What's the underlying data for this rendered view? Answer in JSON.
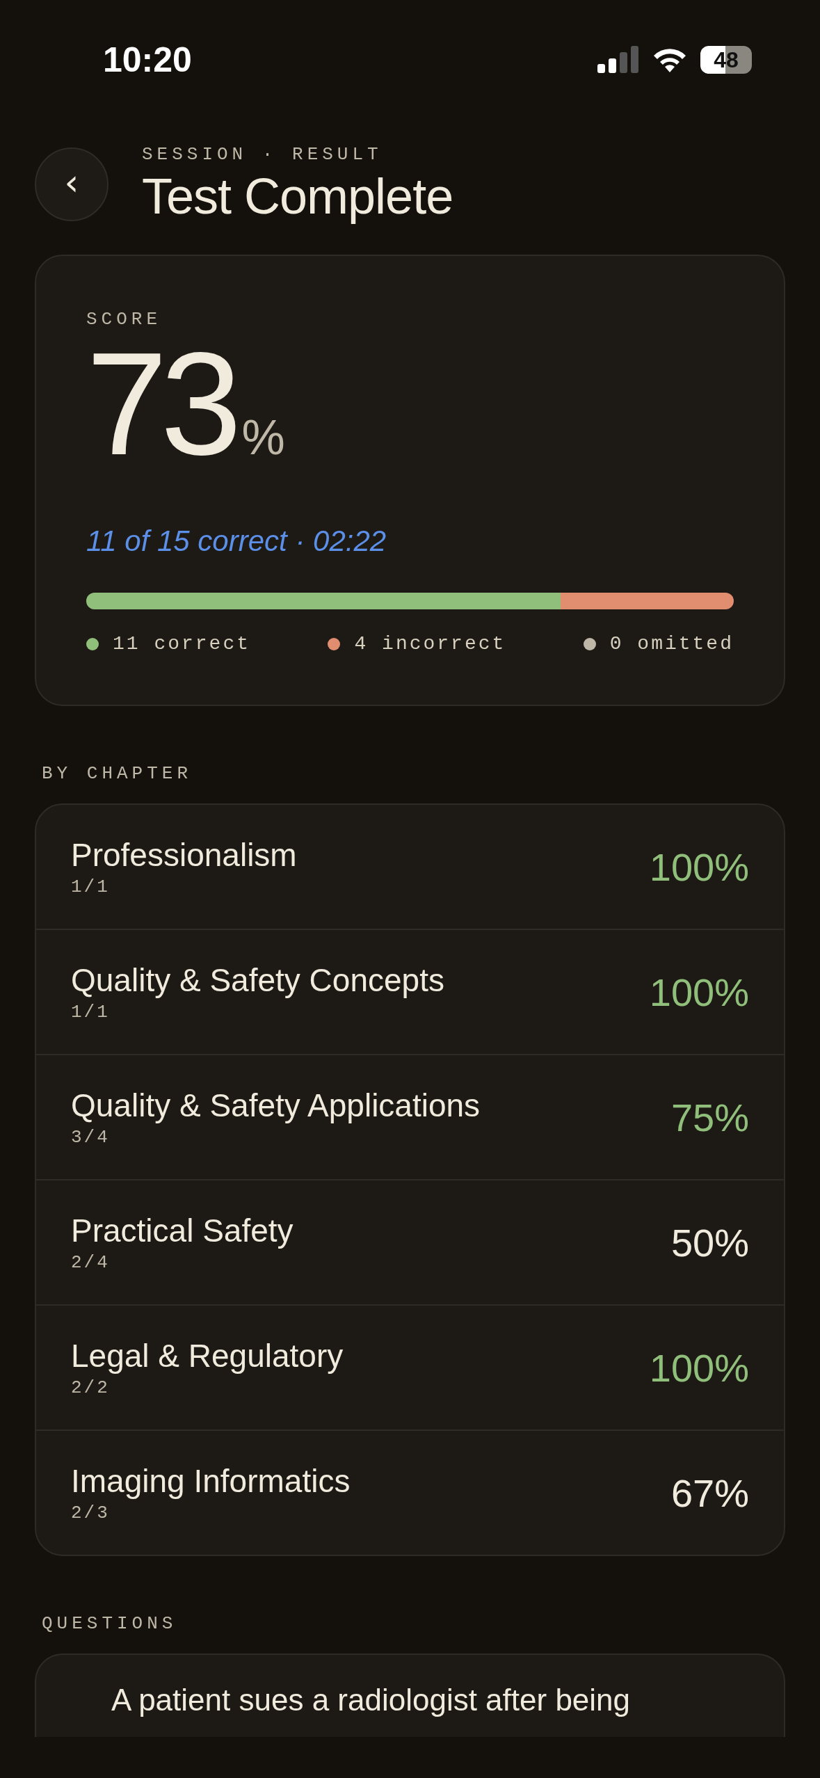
{
  "status_bar": {
    "time": "10:20",
    "battery": "48"
  },
  "header": {
    "eyebrow": "SESSION · RESULT",
    "title": "Test Complete",
    "back": "‹"
  },
  "score": {
    "label": "SCORE",
    "value": "73",
    "unit": "%",
    "summary": "11 of 15 correct · 02:22",
    "segments": [
      {
        "level": 0.733,
        "color": "#8fbf7a"
      },
      {
        "level": 0.267,
        "color": "#e08d70"
      }
    ],
    "legend": [
      {
        "count": "11",
        "label": "correct",
        "color": "#8fbf7a"
      },
      {
        "count": "4",
        "label": "incorrect",
        "color": "#e08d70"
      },
      {
        "count": "0",
        "label": "omitted",
        "color": "#bfb7a7"
      }
    ]
  },
  "chapters_heading": "BY CHAPTER",
  "chapters": [
    {
      "name": "Professionalism",
      "count": "1/1",
      "percent": "100%",
      "passed": true
    },
    {
      "name": "Quality & Safety Concepts",
      "count": "1/1",
      "percent": "100%",
      "passed": true
    },
    {
      "name": "Quality & Safety Applications",
      "count": "3/4",
      "percent": "75%",
      "passed": true
    },
    {
      "name": "Practical Safety",
      "count": "2/4",
      "percent": "50%",
      "passed": false
    },
    {
      "name": "Legal & Regulatory",
      "count": "2/2",
      "percent": "100%",
      "passed": true
    },
    {
      "name": "Imaging Informatics",
      "count": "2/3",
      "percent": "67%",
      "passed": false
    }
  ],
  "questions_heading": "QUESTIONS",
  "questions": [
    {
      "text": "A patient sues a radiologist after being"
    }
  ]
}
